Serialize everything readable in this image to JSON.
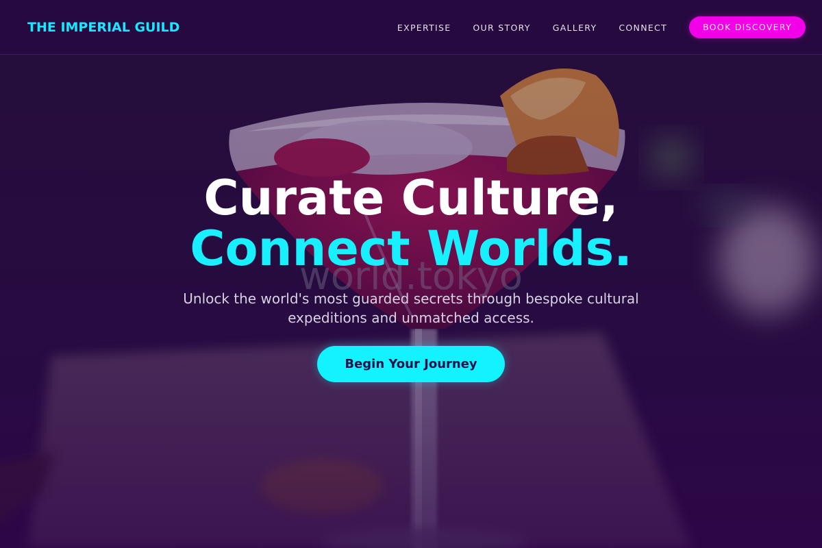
{
  "header": {
    "logo": "THE IMPERIAL GUILD",
    "nav": [
      "EXPERTISE",
      "OUR STORY",
      "GALLERY",
      "CONNECT"
    ],
    "cta_label": "BOOK DISCOVERY"
  },
  "hero": {
    "headline_line1": "Curate Culture,",
    "headline_line2": "Connect Worlds.",
    "watermark": "world.tokyo",
    "subtext": "Unlock the world's most guarded secrets through bespoke cultural expeditions and unmatched access.",
    "button_label": "Begin Your Journey",
    "background_image": "cocktail-margarita-photo"
  },
  "colors": {
    "header_bg": "#26093f",
    "accent_cyan": "#18f0ff",
    "accent_magenta": "#f100e8",
    "hero_overlay": "#2a1043"
  }
}
